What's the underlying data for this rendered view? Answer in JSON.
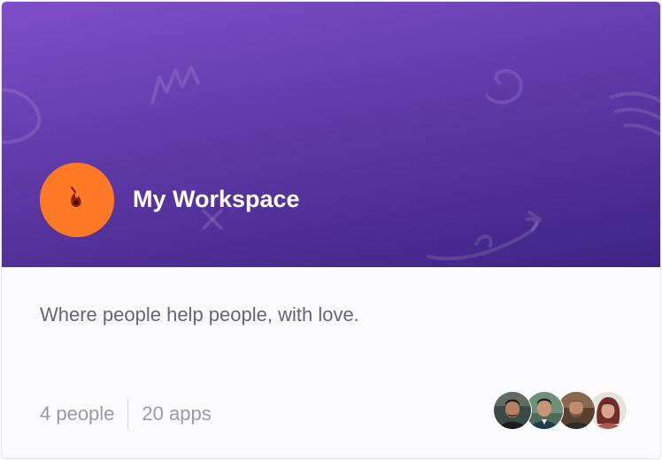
{
  "workspace": {
    "name": "My Workspace",
    "description": "Where people help people, with love.",
    "avatar_color": "#ff7a27",
    "header_gradient": [
      "#7f4fc9",
      "#3f2484"
    ]
  },
  "stats": {
    "people": "4 people",
    "apps": "20 apps"
  },
  "members": [
    {
      "icon": "member-avatar-1-icon"
    },
    {
      "icon": "member-avatar-2-icon"
    },
    {
      "icon": "member-avatar-3-icon"
    },
    {
      "icon": "member-avatar-4-icon"
    }
  ]
}
